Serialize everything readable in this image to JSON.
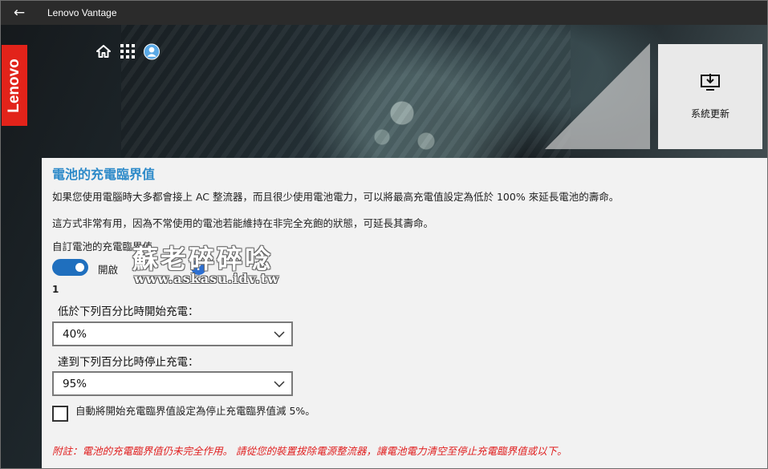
{
  "window": {
    "back_glyph": "←",
    "title": "Lenovo Vantage"
  },
  "brand": {
    "logo_text": "Lenovo"
  },
  "nav_icons": [
    "home-icon",
    "apps-grid-icon",
    "account-icon"
  ],
  "update_tile": {
    "label": "系統更新",
    "icon": "system-update-icon"
  },
  "section": {
    "title": "電池的充電臨界值",
    "desc1": "如果您使用電腦時大多都會接上 AC 整流器，而且很少使用電池電力，可以將最高充電值設定為低於 100% 來延長電池的壽命。",
    "desc2": "這方式非常有用，因為不常使用的電池若能維持在非完全充飽的狀態，可延長其壽命。",
    "custom_label": "自訂電池的充電臨界值",
    "toggle_label": "開啟",
    "toggle_on": true,
    "help_glyph": "?",
    "index_number": "1",
    "start_label": "低於下列百分比時開始充電：",
    "start_value": "40%",
    "stop_label": "達到下列百分比時停止充電：",
    "stop_value": "95%",
    "auto_label": "自動將開始充電臨界值設定為停止充電臨界值減 5%。",
    "auto_checked": false,
    "note": "附註：電池的充電臨界值仍未完全作用。 請從您的裝置拔除電源整流器，讓電池電力清空至停止充電臨界值或以下。"
  },
  "watermark": {
    "text": "蘇老碎碎唸",
    "url": "www.askasu.idv.tw"
  },
  "colors": {
    "accent": "#2d8ac9",
    "toggle": "#1f6fbe",
    "lenovo_red": "#e2231a",
    "note_red": "#e02020",
    "help_blue": "#2d6fd1"
  }
}
